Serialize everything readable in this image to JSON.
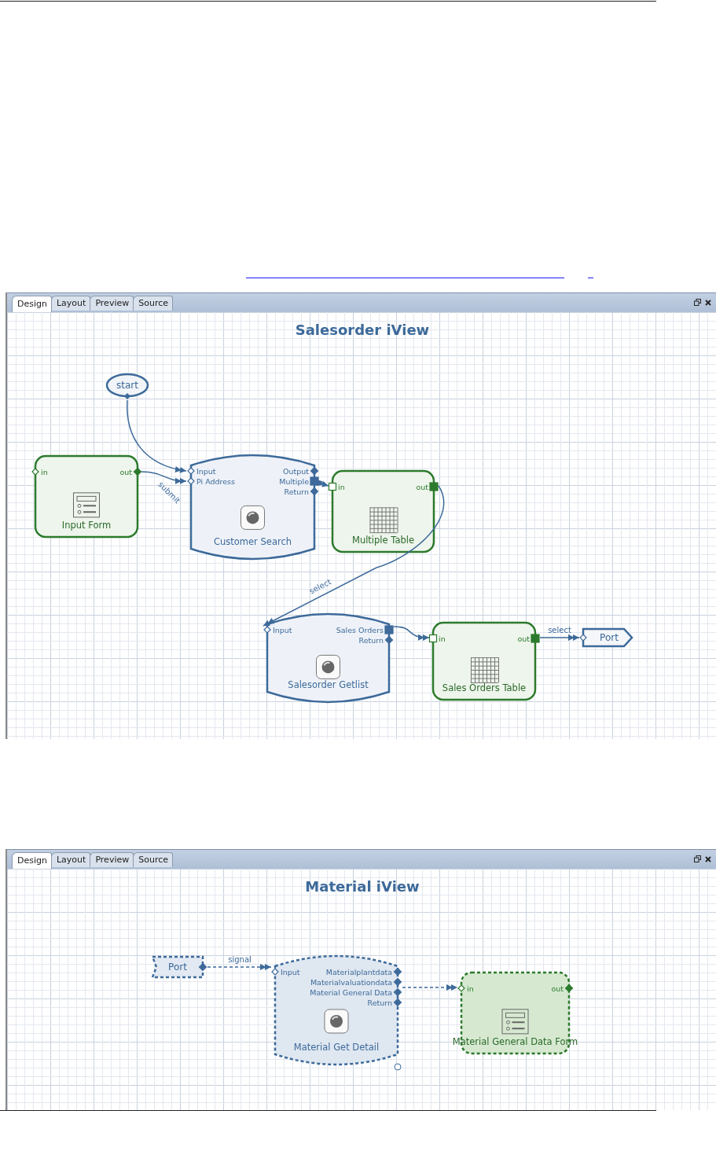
{
  "panels": [
    {
      "tabs": [
        {
          "label": "Design",
          "selected": true
        },
        {
          "label": "Layout",
          "selected": false
        },
        {
          "label": "Preview",
          "selected": false
        },
        {
          "label": "Source",
          "selected": false
        }
      ],
      "title": "Salesorder iView",
      "nodes": [
        {
          "kind": "start",
          "label": "start",
          "dashed": false
        },
        {
          "kind": "form",
          "label": "Input Form",
          "dashed": false,
          "inputs": [
            {
              "label": "in",
              "kind": "diamond-open"
            }
          ],
          "outputs": [
            {
              "label": "out",
              "kind": "diamond"
            }
          ]
        },
        {
          "kind": "service",
          "label": "Customer Search",
          "dashed": false,
          "inputs": [
            {
              "label": "Input",
              "kind": "diamond-open"
            },
            {
              "label": "Pi Address",
              "kind": "diamond-open"
            }
          ],
          "outputs": [
            {
              "label": "Output",
              "kind": "diamond"
            },
            {
              "label": "Multiple",
              "kind": "square"
            },
            {
              "label": "Return",
              "kind": "diamond"
            }
          ]
        },
        {
          "kind": "table",
          "label": "Multiple Table",
          "dashed": false,
          "inputs": [
            {
              "label": "in",
              "kind": "square-open"
            }
          ],
          "outputs": [
            {
              "label": "out",
              "kind": "square"
            }
          ]
        },
        {
          "kind": "service",
          "label": "Salesorder Getlist",
          "dashed": false,
          "inputs": [
            {
              "label": "Input",
              "kind": "diamond-open"
            }
          ],
          "outputs": [
            {
              "label": "Sales Orders",
              "kind": "square"
            },
            {
              "label": "Return",
              "kind": "diamond"
            }
          ]
        },
        {
          "kind": "table",
          "label": "Sales Orders Table",
          "dashed": false,
          "inputs": [
            {
              "label": "in",
              "kind": "square-open"
            }
          ],
          "outputs": [
            {
              "label": "out",
              "kind": "square"
            }
          ]
        },
        {
          "kind": "port",
          "label": "Port",
          "dashed": false,
          "inputs": [
            {
              "kind": "diamond-open"
            }
          ]
        }
      ],
      "connections": [
        {
          "label": "submit",
          "dashed": false
        },
        {
          "label": "select",
          "dashed": false
        },
        {
          "label": "select",
          "dashed": false
        }
      ]
    },
    {
      "tabs": [
        {
          "label": "Design",
          "selected": true
        },
        {
          "label": "Layout",
          "selected": false
        },
        {
          "label": "Preview",
          "selected": false
        },
        {
          "label": "Source",
          "selected": false
        }
      ],
      "title": "Material iView",
      "nodes": [
        {
          "kind": "port",
          "label": "Port",
          "dashed": true,
          "outputs": [
            {
              "kind": "diamond"
            }
          ]
        },
        {
          "kind": "service",
          "label": "Material Get Detail",
          "dashed": true,
          "inputs": [
            {
              "label": "Input",
              "kind": "diamond-open"
            }
          ],
          "outputs": [
            {
              "label": "Materialplantdata",
              "kind": "diamond"
            },
            {
              "label": "Materialvaluationdata",
              "kind": "diamond"
            },
            {
              "label": "Material General Data",
              "kind": "diamond"
            },
            {
              "label": "Return",
              "kind": "diamond"
            }
          ]
        },
        {
          "kind": "form",
          "label": "Material General Data Form",
          "dashed": true,
          "inputs": [
            {
              "label": "in",
              "kind": "diamond-open"
            }
          ],
          "outputs": [
            {
              "label": "out",
              "kind": "diamond"
            }
          ]
        }
      ],
      "connections": [
        {
          "label": "signal",
          "dashed": true
        }
      ]
    }
  ]
}
